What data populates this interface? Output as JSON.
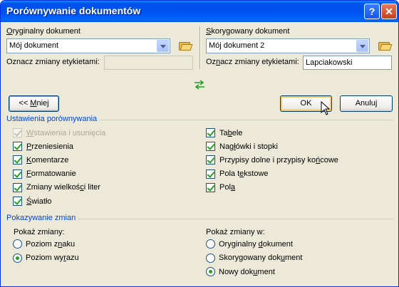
{
  "window": {
    "title": "Porównywanie dokumentów"
  },
  "titlebar_buttons": {
    "help": "?",
    "close": "✕"
  },
  "original": {
    "label_pre": "",
    "label_ul": "O",
    "label_post": "ryginalny dokument",
    "value": "Mój dokument",
    "tag_label": "Oznacz zmiany etykietami:",
    "tag_value": ""
  },
  "revised": {
    "label_pre": "",
    "label_ul": "S",
    "label_post": "korygowany dokument",
    "value": "Mój dokument 2",
    "tag_label_pre": "Oz",
    "tag_label_ul": "n",
    "tag_label_post": "acz zmiany etykietami:",
    "tag_value": "Lapciakowski"
  },
  "buttons": {
    "less_pre": "<< ",
    "less_ul": "M",
    "less_post": "niej",
    "ok": "OK",
    "cancel": "Anuluj"
  },
  "comparison_settings": {
    "title": "Ustawienia porównywania",
    "left": [
      {
        "pre": "",
        "ul": "W",
        "post": "stawienia i usunięcia",
        "checked": true,
        "disabled": true
      },
      {
        "pre": "",
        "ul": "P",
        "post": "rzeniesienia",
        "checked": true,
        "disabled": false
      },
      {
        "pre": "",
        "ul": "K",
        "post": "omentarze",
        "checked": true,
        "disabled": false
      },
      {
        "pre": "",
        "ul": "F",
        "post": "ormatowanie",
        "checked": true,
        "disabled": false
      },
      {
        "pre": "Zmiany wielkoś",
        "ul": "c",
        "post": "i liter",
        "checked": true,
        "disabled": false
      },
      {
        "pre": "",
        "ul": "Ś",
        "post": "wiatło",
        "checked": true,
        "disabled": false
      }
    ],
    "right": [
      {
        "pre": "Ta",
        "ul": "b",
        "post": "ele",
        "checked": true,
        "disabled": false
      },
      {
        "pre": "Nag",
        "ul": "ł",
        "post": "ówki i stopki",
        "checked": true,
        "disabled": false
      },
      {
        "pre": "Przypisy dolne i przypisy ko",
        "ul": "ń",
        "post": "cowe",
        "checked": true,
        "disabled": false
      },
      {
        "pre": "Pola t",
        "ul": "e",
        "post": "kstowe",
        "checked": true,
        "disabled": false
      },
      {
        "pre": "Pol",
        "ul": "a",
        "post": "",
        "checked": true,
        "disabled": false
      }
    ]
  },
  "show_changes": {
    "title": "Pokazywanie zmian",
    "left_label": "Pokaż zmiany:",
    "left_options": [
      {
        "pre": "Poziom z",
        "ul": "n",
        "post": "aku",
        "selected": false
      },
      {
        "pre": "Poziom wy",
        "ul": "r",
        "post": "azu",
        "selected": true
      }
    ],
    "right_label": "Pokaż zmiany w:",
    "right_options": [
      {
        "pre": "Oryginalny ",
        "ul": "d",
        "post": "okument",
        "selected": false
      },
      {
        "pre": "Skorygowany dok",
        "ul": "u",
        "post": "ment",
        "selected": false
      },
      {
        "pre": "Nowy dok",
        "ul": "u",
        "post": "ment",
        "selected": true
      }
    ]
  },
  "icons": {
    "folder": "folder-open-icon",
    "swap": "swap-arrows-icon",
    "cursor": "mouse-pointer-icon"
  },
  "colors": {
    "titlebar": "#0054e3",
    "dialog_bg": "#ece9d8",
    "section_title": "#0046d5",
    "check_mark": "#21a121"
  }
}
